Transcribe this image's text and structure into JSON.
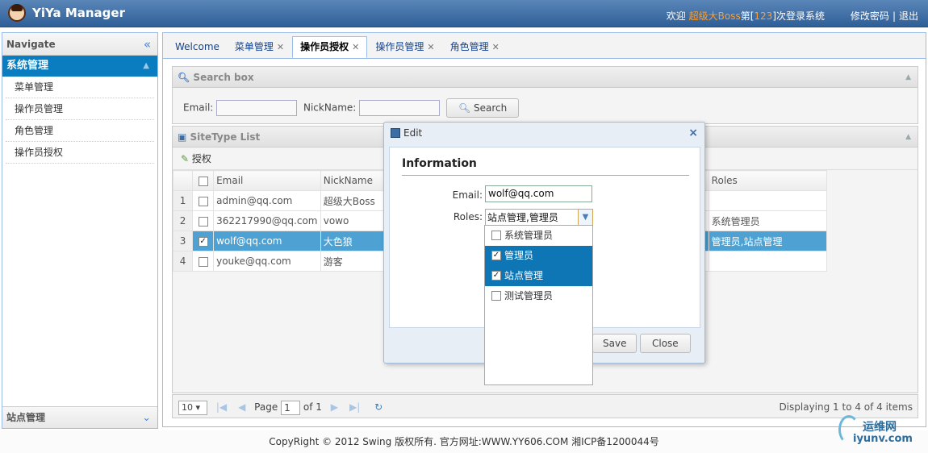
{
  "app": {
    "title": "YiYa Manager"
  },
  "header": {
    "welcome_prefix": "欢迎",
    "user_name": "超级大Boss",
    "login_prefix": "第[",
    "login_count": "123",
    "login_suffix": "]次登录系统",
    "change_password": "修改密码",
    "separator": "|",
    "logout": "退出"
  },
  "sidebar": {
    "title": "Navigate",
    "group_title": "系统管理",
    "items": [
      {
        "label": "菜单管理"
      },
      {
        "label": "操作员管理"
      },
      {
        "label": "角色管理"
      },
      {
        "label": "操作员授权"
      }
    ],
    "bottom_group": "站点管理"
  },
  "tabs": [
    {
      "label": "Welcome",
      "closable": false,
      "active": false
    },
    {
      "label": "菜单管理",
      "closable": true,
      "active": false
    },
    {
      "label": "操作员授权",
      "closable": true,
      "active": true
    },
    {
      "label": "操作员管理",
      "closable": true,
      "active": false
    },
    {
      "label": "角色管理",
      "closable": true,
      "active": false
    }
  ],
  "search": {
    "title": "Search box",
    "email_label": "Email:",
    "email_value": "",
    "nickname_label": "NickName:",
    "nickname_value": "",
    "button": "Search"
  },
  "list": {
    "title": "SiteType List",
    "toolbar_authorize": "授权",
    "columns": {
      "email": "Email",
      "nickname": "NickName",
      "roles": "Roles"
    },
    "rows": [
      {
        "num": "1",
        "email": "admin@qq.com",
        "nickname": "超级大Boss",
        "roles": "",
        "checked": false,
        "selected": false
      },
      {
        "num": "2",
        "email": "362217990@qq.com",
        "nickname": "vowo",
        "roles": "系统管理员",
        "checked": false,
        "selected": false
      },
      {
        "num": "3",
        "email": "wolf@qq.com",
        "nickname": "大色狼",
        "roles": "管理员,站点管理",
        "checked": true,
        "selected": true
      },
      {
        "num": "4",
        "email": "youke@qq.com",
        "nickname": "游客",
        "roles": "",
        "checked": false,
        "selected": false
      }
    ]
  },
  "pager": {
    "page_size": "10",
    "page_label": "Page",
    "page_value": "1",
    "of_label": "of 1",
    "display_text": "Displaying 1 to 4 of 4 items"
  },
  "dialog": {
    "title": "Edit",
    "section_title": "Information",
    "email_label": "Email:",
    "email_value": "wolf@qq.com",
    "roles_label": "Roles:",
    "roles_value": "站点管理,管理员",
    "save": "Save",
    "close": "Close",
    "options": [
      {
        "label": "系统管理员",
        "checked": false
      },
      {
        "label": "管理员",
        "checked": true
      },
      {
        "label": "站点管理",
        "checked": true
      },
      {
        "label": "测试管理员",
        "checked": false
      }
    ]
  },
  "footer": {
    "text": "CopyRight © 2012 Swing 版权所有.  官方网址:WWW.YY606.COM  湘ICP备1200044号"
  },
  "watermark": {
    "top": "运维网",
    "bottom": "iyunv.com"
  }
}
